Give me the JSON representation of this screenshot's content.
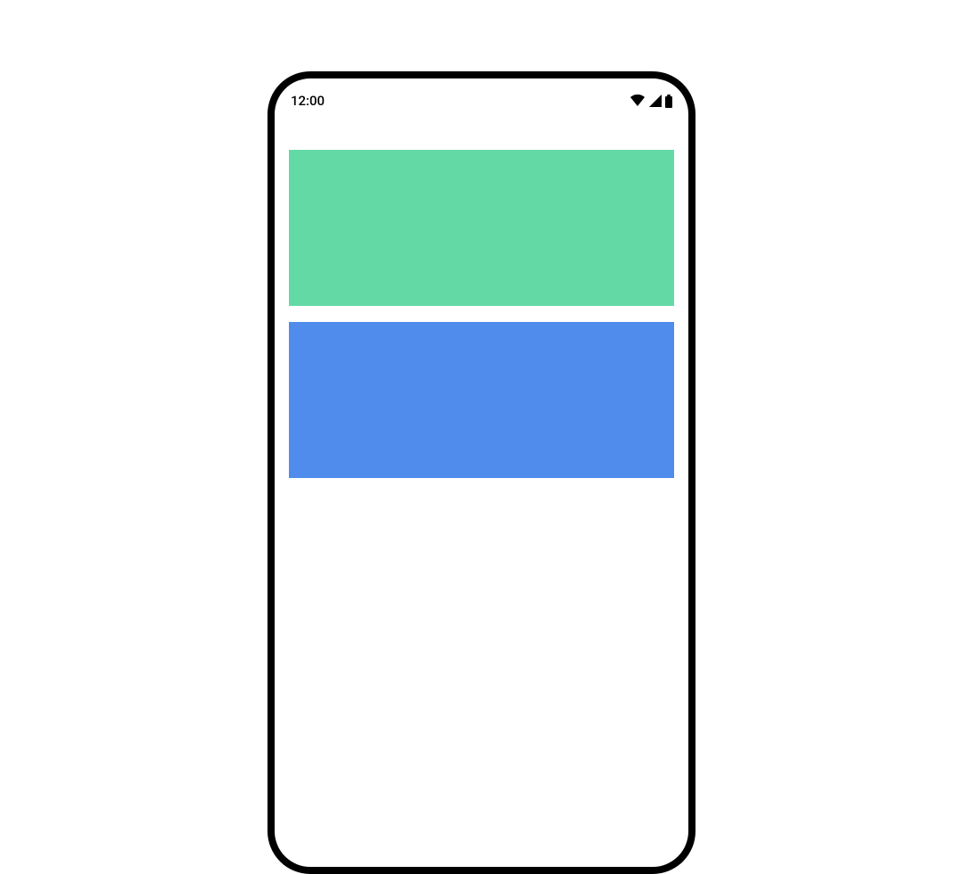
{
  "status": {
    "time": "12:00"
  },
  "blocks": {
    "green_color": "#63d9a6",
    "blue_color": "#4f8ceb"
  }
}
